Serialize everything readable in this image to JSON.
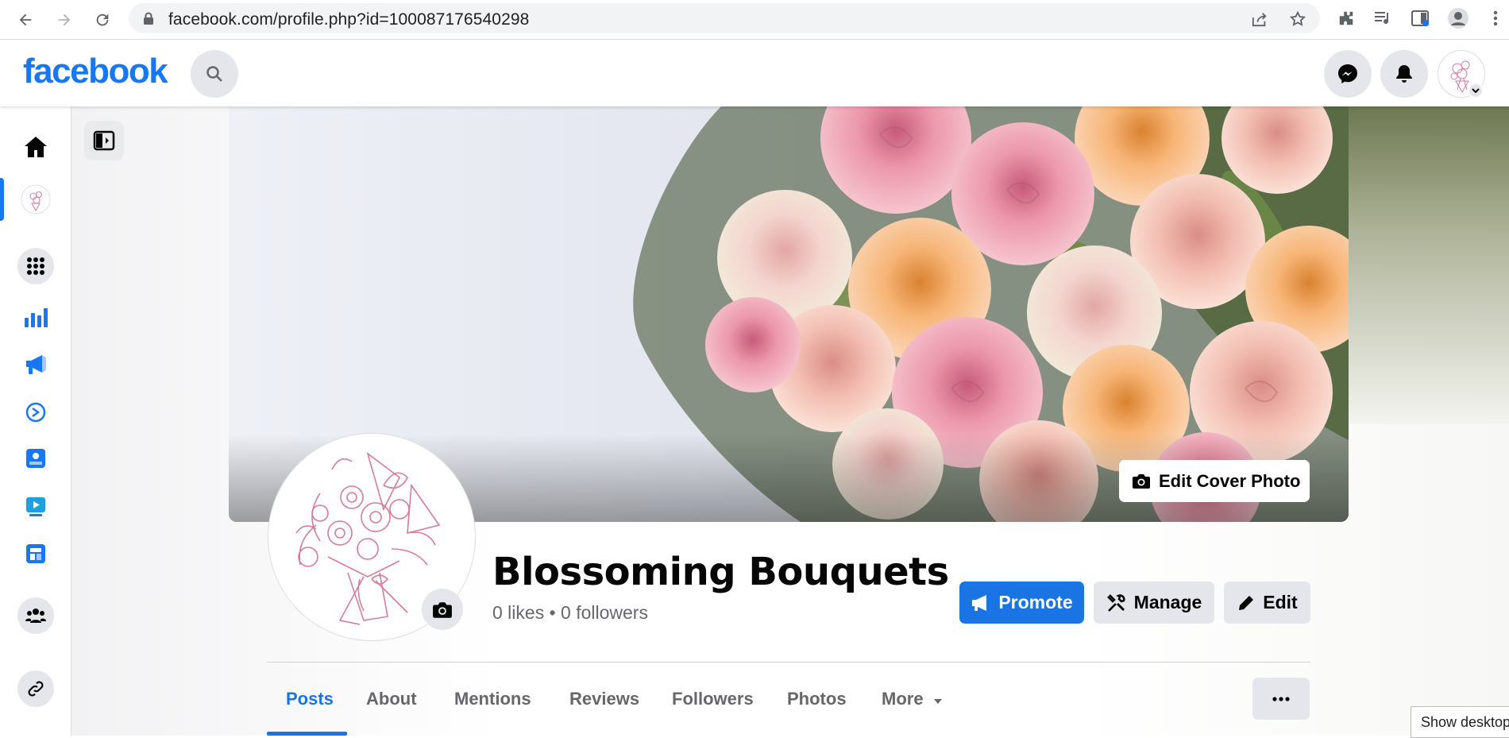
{
  "browser": {
    "url": "facebook.com/profile.php?id=100087176540298"
  },
  "fb": {
    "logo": "facebook"
  },
  "page": {
    "name": "Blossoming Bouquets",
    "stats": "0 likes • 0 followers",
    "edit_cover_label": "Edit Cover Photo"
  },
  "actions": {
    "promote": "Promote",
    "manage": "Manage",
    "edit": "Edit"
  },
  "tabs": [
    "Posts",
    "About",
    "Mentions",
    "Reviews",
    "Followers",
    "Photos",
    "More"
  ],
  "tooltip": "Show desktop",
  "colors": {
    "brand": "#1877f2",
    "accent": "#1b74e4",
    "secondary_bg": "#e4e6eb"
  }
}
